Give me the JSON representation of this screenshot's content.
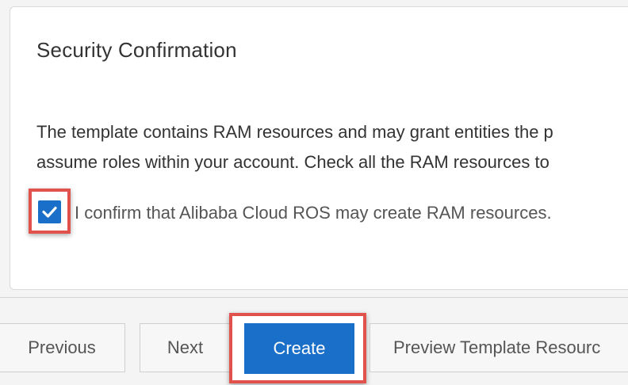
{
  "security": {
    "title": "Security Confirmation",
    "description_line1": "The template contains RAM resources and may grant entities the p",
    "description_line2": "assume roles within your account. Check all the RAM resources to",
    "confirm_label": "I confirm that Alibaba Cloud ROS may create RAM resources.",
    "confirm_checked": true
  },
  "footer": {
    "previous_label": "Previous",
    "next_label": "Next",
    "create_label": "Create",
    "preview_label": "Preview Template Resourc"
  },
  "colors": {
    "primary": "#1a6fc9",
    "highlight": "#e2524c"
  }
}
